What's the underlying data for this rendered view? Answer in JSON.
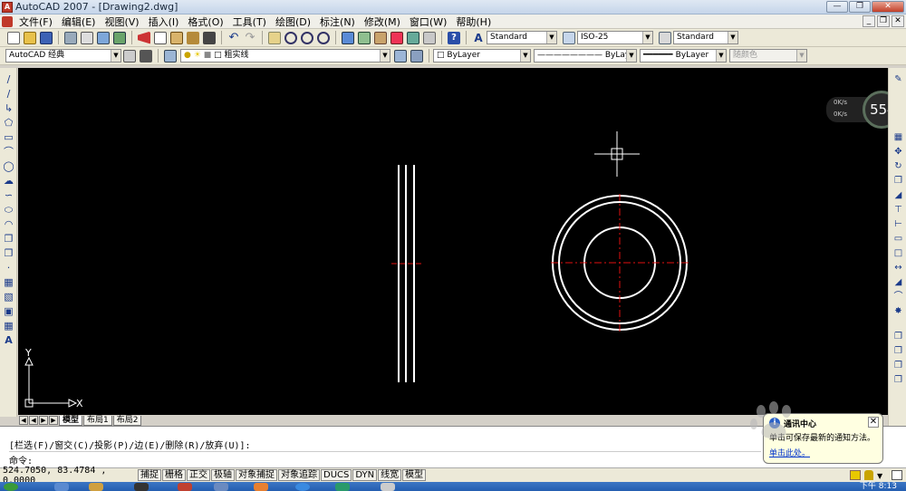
{
  "window": {
    "title": "AutoCAD 2007 - [Drawing2.dwg]"
  },
  "menu": {
    "items": [
      "文件(F)",
      "编辑(E)",
      "视图(V)",
      "插入(I)",
      "格式(O)",
      "工具(T)",
      "绘图(D)",
      "标注(N)",
      "修改(M)",
      "窗口(W)",
      "帮助(H)"
    ]
  },
  "toolbar": {
    "text_style": "Standard",
    "dim_style": "ISO-25",
    "table_style": "Standard",
    "workspace": "AutoCAD 经典",
    "layer": "粗实线",
    "color": "ByLayer",
    "linetype": "ByLayer",
    "lineweight": "ByLayer",
    "plotstyle": "随颜色"
  },
  "ucs": {
    "x_label": "X",
    "y_label": "Y"
  },
  "layout_tabs": [
    "模型",
    "布局1",
    "布局2"
  ],
  "command": {
    "history": "[栏选(F)/窗交(C)/投影(P)/边(E)/删除(R)/放弃(U)]:",
    "prompt": "命令:"
  },
  "status": {
    "coordinates": "524.7050, 83.4784 , 0.0000",
    "buttons": [
      "捕捉",
      "栅格",
      "正交",
      "极轴",
      "对象捕捉",
      "对象追踪",
      "DUCS",
      "DYN",
      "线宽",
      "模型"
    ]
  },
  "net_widget": {
    "up": "0K/s",
    "down": "0K/s",
    "percent": "55",
    "unit": "%"
  },
  "balloon": {
    "title": "通讯中心",
    "text": "单击可保存最新的通知方法。",
    "link": "单击此处。"
  },
  "taskbar": {
    "clock": "下午 8:13"
  },
  "colors": {
    "canvas": "#000000",
    "centerline": "#e01010",
    "geometry": "#ffffff"
  }
}
